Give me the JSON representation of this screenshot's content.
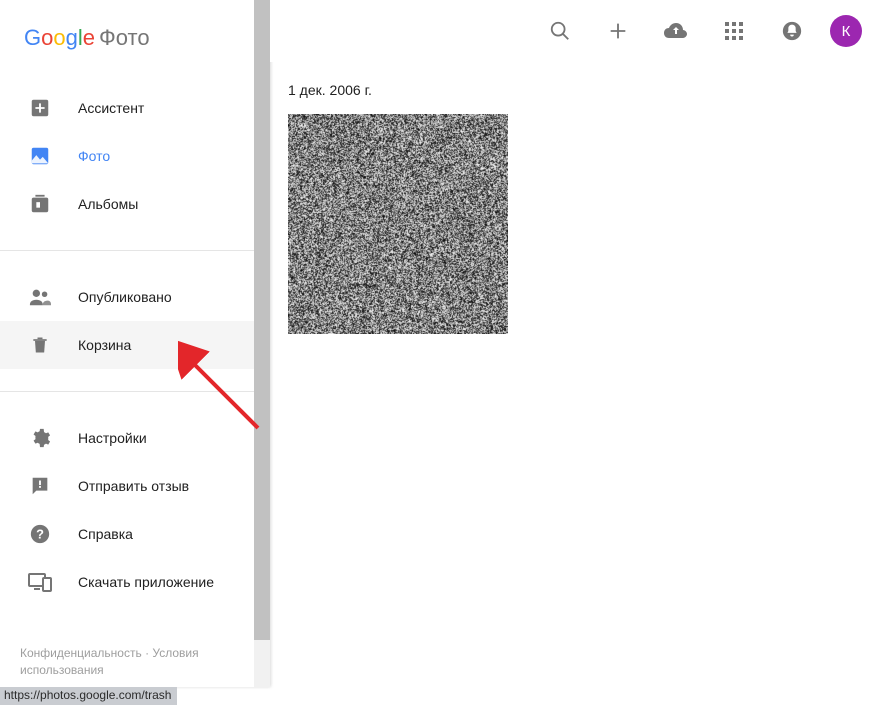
{
  "logo": {
    "google": "Google",
    "app": "Фото"
  },
  "sidebar": {
    "groups": [
      {
        "items": [
          {
            "key": "assistant",
            "label": "Ассистент"
          },
          {
            "key": "photos",
            "label": "Фото",
            "selected": true
          },
          {
            "key": "albums",
            "label": "Альбомы"
          }
        ]
      },
      {
        "items": [
          {
            "key": "sharing",
            "label": "Опубликовано"
          },
          {
            "key": "trash",
            "label": "Корзина",
            "hovered": true
          }
        ]
      },
      {
        "items": [
          {
            "key": "settings",
            "label": "Настройки"
          },
          {
            "key": "feedback",
            "label": "Отправить отзыв"
          },
          {
            "key": "help",
            "label": "Справка"
          },
          {
            "key": "getapp",
            "label": "Скачать приложение"
          }
        ]
      }
    ]
  },
  "footer": {
    "privacy": "Конфиденциальность",
    "sep": " · ",
    "terms": "Условия использования"
  },
  "content": {
    "date_header": "1 дек. 2006 г."
  },
  "avatar_letter": "К",
  "status_url": "https://photos.google.com/trash"
}
